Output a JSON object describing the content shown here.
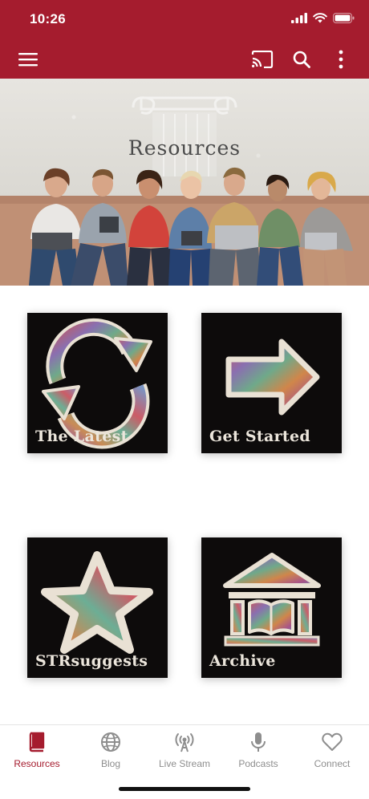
{
  "status": {
    "time": "10:26"
  },
  "app": {
    "accent": "#a51c2e"
  },
  "hero": {
    "title": "Resources",
    "slides": 2,
    "active_slide": 1
  },
  "tiles": [
    {
      "label": "The Latest",
      "icon": "refresh-icon"
    },
    {
      "label": "Get Started",
      "icon": "arrow-right-icon"
    },
    {
      "label": "STRsuggests",
      "icon": "star-icon"
    },
    {
      "label": "Archive",
      "icon": "library-icon"
    }
  ],
  "tabs": [
    {
      "label": "Resources",
      "icon": "book-icon",
      "active": true
    },
    {
      "label": "Blog",
      "icon": "globe-icon",
      "active": false
    },
    {
      "label": "Live Stream",
      "icon": "broadcast-icon",
      "active": false
    },
    {
      "label": "Podcasts",
      "icon": "microphone-icon",
      "active": false
    },
    {
      "label": "Connect",
      "icon": "heart-icon",
      "active": false
    }
  ]
}
